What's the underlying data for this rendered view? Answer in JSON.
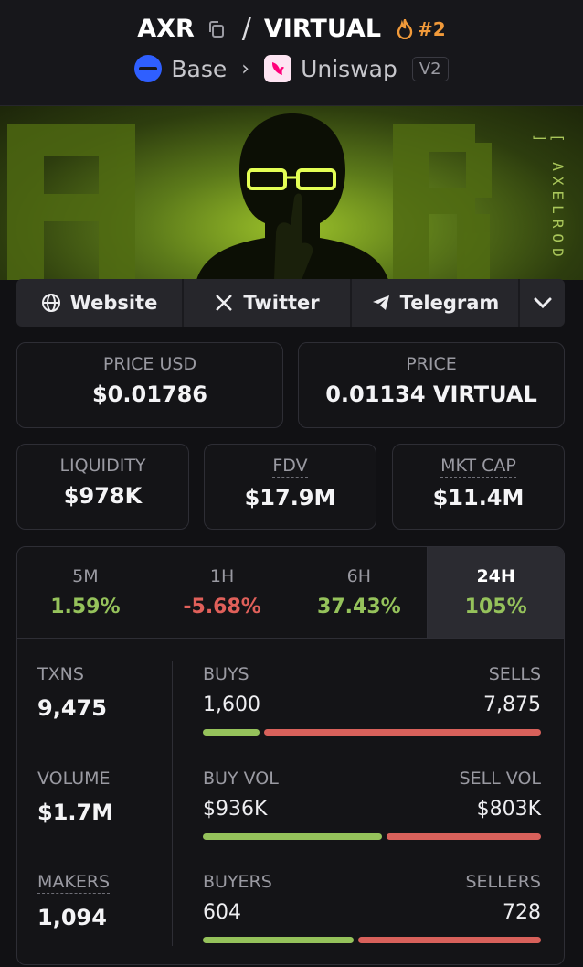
{
  "header": {
    "base_symbol": "AXR",
    "slash": "/",
    "quote_symbol": "VIRTUAL",
    "rank": "#2",
    "chain": "Base",
    "dex": "Uniswap",
    "version": "V2"
  },
  "banner": {
    "side_text": "[ AXELROD ]"
  },
  "links": {
    "website": "Website",
    "twitter": "Twitter",
    "telegram": "Telegram"
  },
  "prices": {
    "usd_label": "PRICE USD",
    "usd_value": "$0.01786",
    "native_label": "PRICE",
    "native_value": "0.01134 VIRTUAL"
  },
  "market": {
    "liquidity_label": "LIQUIDITY",
    "liquidity_value": "$978K",
    "fdv_label": "FDV",
    "fdv_value": "$17.9M",
    "mcap_label": "MKT CAP",
    "mcap_value": "$11.4M"
  },
  "periods": [
    {
      "label": "5M",
      "value": "1.59%",
      "trend": "up"
    },
    {
      "label": "1H",
      "value": "-5.68%",
      "trend": "down"
    },
    {
      "label": "6H",
      "value": "37.43%",
      "trend": "up"
    },
    {
      "label": "24H",
      "value": "105%",
      "trend": "up",
      "active": true
    }
  ],
  "metrics": {
    "txns_label": "TXNS",
    "txns_value": "9,475",
    "volume_label": "VOLUME",
    "volume_value": "$1.7M",
    "makers_label": "MAKERS",
    "makers_value": "1,094",
    "buys_label": "BUYS",
    "buys_value": "1,600",
    "sells_label": "SELLS",
    "sells_value": "7,875",
    "buys_share": 0.169,
    "buy_vol_label": "BUY VOL",
    "buy_vol_value": "$936K",
    "sell_vol_label": "SELL VOL",
    "sell_vol_value": "$803K",
    "buy_vol_share": 0.538,
    "buyers_label": "BUYERS",
    "buyers_value": "604",
    "sellers_label": "SELLERS",
    "sellers_value": "728",
    "buyers_share": 0.453
  },
  "colors": {
    "positive": "#95c25b",
    "negative": "#e0605a",
    "rank": "#f19a3a",
    "base_chain": "#2f5fff"
  }
}
